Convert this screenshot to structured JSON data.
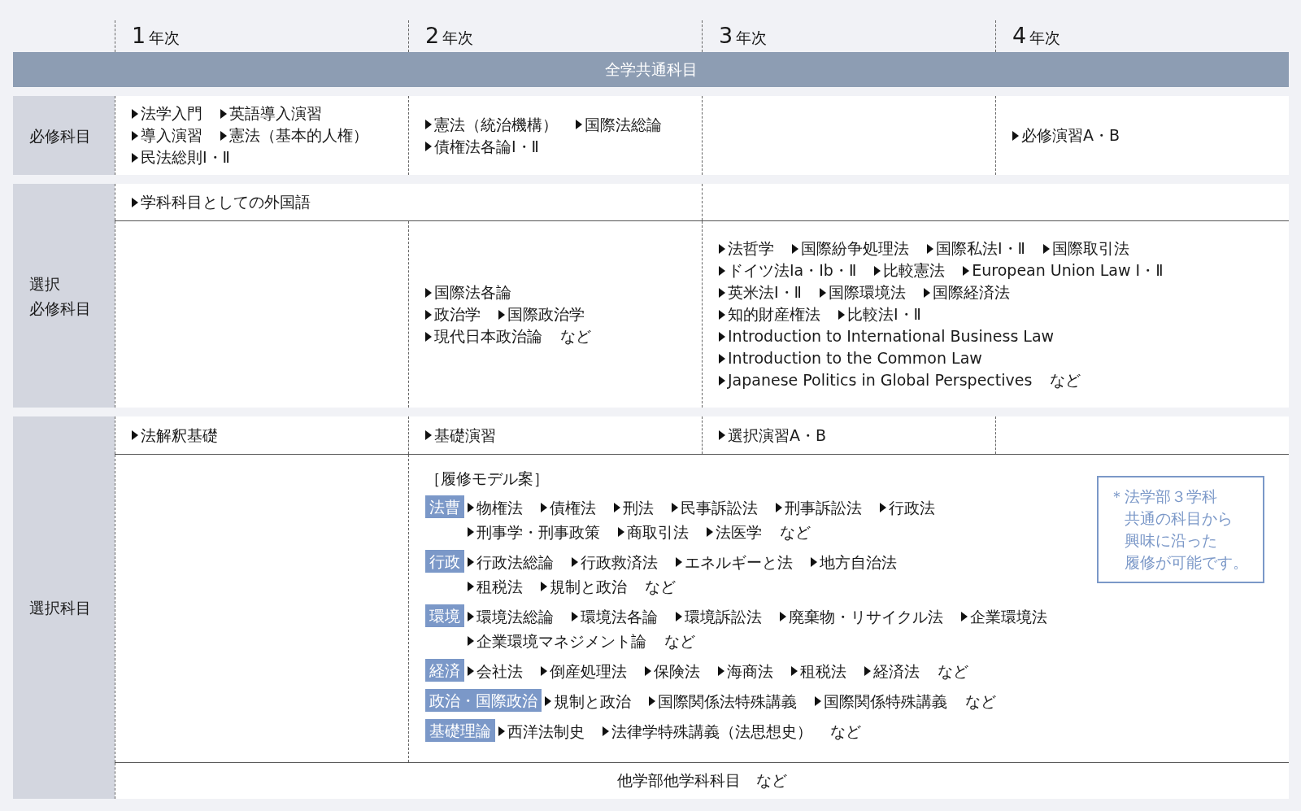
{
  "year_headers": [
    {
      "number": "1",
      "unit": "年次"
    },
    {
      "number": "2",
      "unit": "年次"
    },
    {
      "number": "3",
      "unit": "年次"
    },
    {
      "number": "4",
      "unit": "年次"
    }
  ],
  "common_band": "全学共通科目",
  "sections": [
    {
      "label": [
        "必修科目"
      ],
      "rows": [
        {
          "cells": [
            {
              "kind": "list",
              "lines": [
                {
                  "items": [
                    "法学入門",
                    "英語導入演習"
                  ]
                },
                {
                  "items": [
                    "導入演習",
                    "憲法（基本的人権）"
                  ]
                },
                {
                  "items": [
                    "民法総則Ⅰ・Ⅱ"
                  ]
                }
              ]
            },
            {
              "kind": "list",
              "lines": [
                {
                  "items": [
                    "憲法（統治機構）",
                    "国際法総論"
                  ]
                },
                {
                  "items": [
                    "債権法各論Ⅰ・Ⅱ"
                  ]
                }
              ]
            },
            {
              "kind": "empty"
            },
            {
              "kind": "list",
              "lines": [
                {
                  "items": [
                    "必修演習A・B"
                  ]
                }
              ]
            }
          ]
        }
      ]
    },
    {
      "label": [
        "選択",
        "必修科目"
      ],
      "rows": [
        {
          "cells": [
            {
              "kind": "list",
              "lines": [
                {
                  "items": [
                    "学科科目としての外国語"
                  ]
                }
              ]
            },
            {
              "kind": "empty"
            }
          ]
        },
        {
          "cells": [
            {
              "kind": "empty"
            },
            {
              "kind": "list",
              "lines": [
                {
                  "items": [
                    "国際法各論"
                  ]
                },
                {
                  "items": [
                    "政治学",
                    "国際政治学"
                  ]
                },
                {
                  "items": [
                    "現代日本政治論"
                  ],
                  "suffix": "など"
                }
              ]
            },
            {
              "kind": "list",
              "lines": [
                {
                  "items": [
                    "法哲学",
                    "国際紛争処理法",
                    "国際私法Ⅰ・Ⅱ",
                    "国際取引法"
                  ]
                },
                {
                  "items": [
                    "ドイツ法Ⅰa・Ⅰb・Ⅱ",
                    "比較憲法",
                    "European Union Law Ⅰ・Ⅱ"
                  ]
                },
                {
                  "items": [
                    "英米法Ⅰ・Ⅱ",
                    "国際環境法",
                    "国際経済法"
                  ]
                },
                {
                  "items": [
                    "知的財産権法",
                    "比較法Ⅰ・Ⅱ"
                  ]
                },
                {
                  "items": [
                    "Introduction to International  Business Law"
                  ]
                },
                {
                  "items": [
                    "Introduction to the Common Law"
                  ]
                },
                {
                  "items": [
                    "Japanese Politics in Global Perspectives"
                  ],
                  "suffix": "など"
                }
              ]
            }
          ]
        }
      ]
    },
    {
      "label": [
        "選択科目"
      ],
      "rows": [
        {
          "cells": [
            {
              "kind": "list",
              "lines": [
                {
                  "items": [
                    "法解釈基礎"
                  ]
                }
              ]
            },
            {
              "kind": "list",
              "lines": [
                {
                  "items": [
                    "基礎演習"
                  ]
                }
              ]
            },
            {
              "kind": "list",
              "lines": [
                {
                  "items": [
                    "選択演習A・B"
                  ]
                }
              ]
            },
            {
              "kind": "empty"
            }
          ]
        },
        {
          "cells": [
            {
              "kind": "empty"
            },
            {
              "kind": "model",
              "title": "［履修モデル案］",
              "groups": [
                {
                  "tag": "法曹",
                  "lines": [
                    {
                      "items": [
                        "物権法",
                        "債権法",
                        "刑法",
                        "民事訴訟法",
                        "刑事訴訟法",
                        "行政法"
                      ]
                    },
                    {
                      "items": [
                        "刑事学・刑事政策",
                        "商取引法",
                        "法医学"
                      ],
                      "suffix": "など"
                    }
                  ]
                },
                {
                  "tag": "行政",
                  "lines": [
                    {
                      "items": [
                        "行政法総論",
                        "行政救済法",
                        "エネルギーと法",
                        "地方自治法"
                      ]
                    },
                    {
                      "items": [
                        "租税法",
                        "規制と政治"
                      ],
                      "suffix": "など"
                    }
                  ]
                },
                {
                  "tag": "環境",
                  "lines": [
                    {
                      "items": [
                        "環境法総論",
                        "環境法各論",
                        "環境訴訟法",
                        "廃棄物・リサイクル法",
                        "企業環境法"
                      ]
                    },
                    {
                      "items": [
                        "企業環境マネジメント論"
                      ],
                      "suffix": "など"
                    }
                  ]
                },
                {
                  "tag": "経済",
                  "lines": [
                    {
                      "items": [
                        "会社法",
                        "倒産処理法",
                        "保険法",
                        "海商法",
                        "租税法",
                        "経済法"
                      ],
                      "suffix": "など"
                    }
                  ]
                },
                {
                  "tag": "政治・国際政治",
                  "lines": [
                    {
                      "items": [
                        "規制と政治",
                        "国際関係法特殊講義",
                        "国際関係特殊講義"
                      ],
                      "suffix": "など"
                    }
                  ]
                },
                {
                  "tag": "基礎理論",
                  "lines": [
                    {
                      "items": [
                        "西洋法制史",
                        "法律学特殊講義（法思想史）"
                      ],
                      "suffix": "など"
                    }
                  ]
                }
              ],
              "note": [
                "＊法学部３学科",
                "共通の科目から",
                "興味に沿った",
                "履修が可能です。"
              ]
            }
          ]
        }
      ],
      "footer": "他学部他学科科目　など"
    }
  ]
}
